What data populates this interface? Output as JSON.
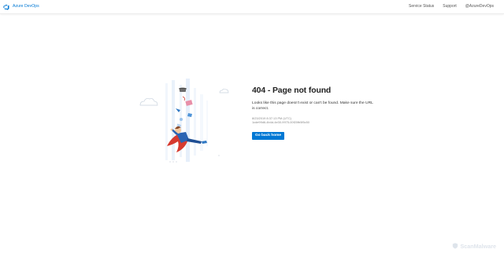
{
  "header": {
    "brand_name": "Azure DevOps",
    "nav": [
      "Service Status",
      "Support",
      "@AzureDevOps"
    ]
  },
  "error": {
    "title": "404 - Page not found",
    "message": "Looks like this page doesn't exist or can't be found. Make sure the URL is correct.",
    "timestamp": "8/23/2019 8:37:13 PM (UTC)",
    "activity_id": "1cde99d6-4b4d-4e30-9975-00f20fb5f5c50",
    "button_label": "Go back home"
  },
  "watermark": {
    "text": "ScanMalware"
  },
  "colors": {
    "accent": "#0078d4"
  }
}
